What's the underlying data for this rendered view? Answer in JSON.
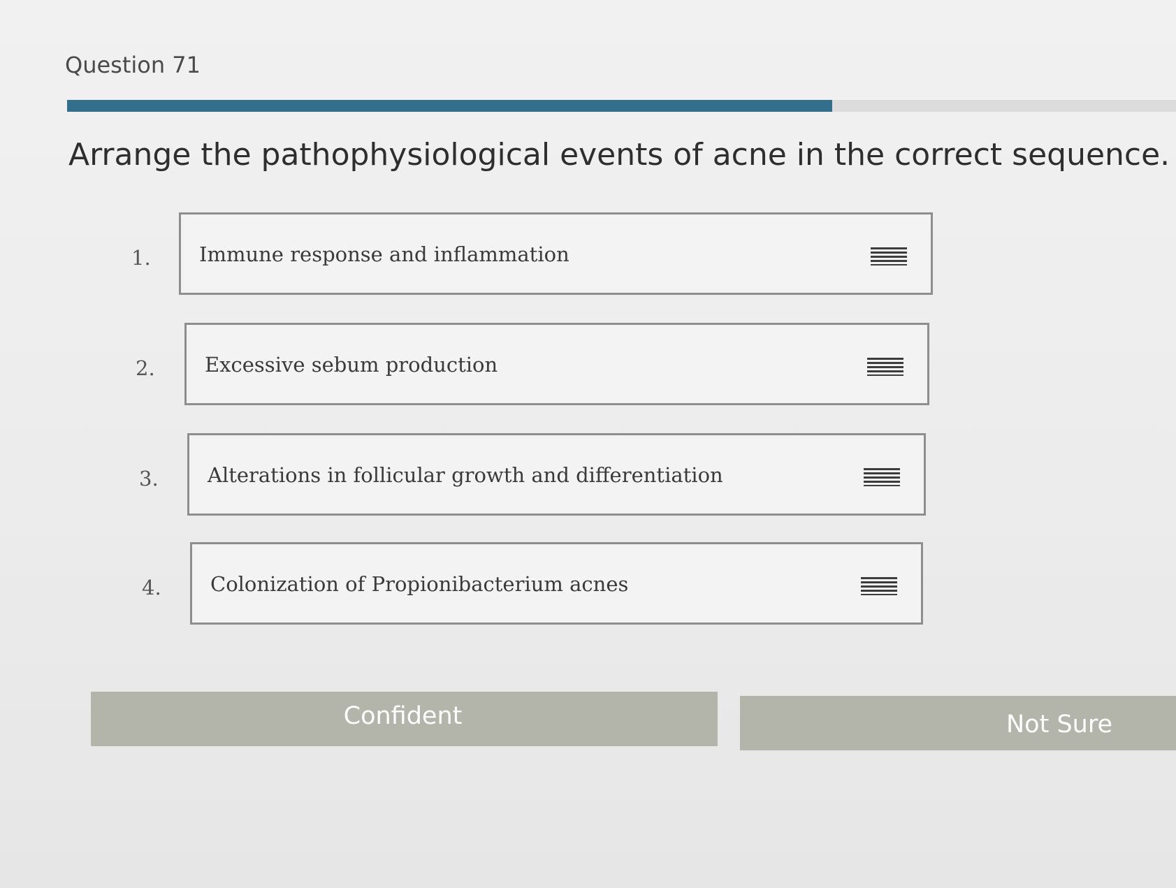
{
  "question": {
    "number_label": "Question 71",
    "progress_percent": 69,
    "prompt": "Arrange the pathophysiological events of acne in the correct sequence."
  },
  "items": [
    {
      "index": "1.",
      "label": "Immune response and inflammation",
      "icon": "drag-handle-icon"
    },
    {
      "index": "2.",
      "label": "Excessive sebum production",
      "icon": "drag-handle-icon"
    },
    {
      "index": "3.",
      "label": "Alterations in follicular growth and differentiation",
      "icon": "drag-handle-icon"
    },
    {
      "index": "4.",
      "label": "Colonization of Propionibacterium acnes",
      "icon": "drag-handle-icon"
    }
  ],
  "actions": {
    "confident_label": "Confident",
    "not_sure_label": "Not Sure"
  },
  "colors": {
    "progress": "#336f8c",
    "button_bg": "#b3b5ab",
    "item_border": "#8e8e8e"
  }
}
